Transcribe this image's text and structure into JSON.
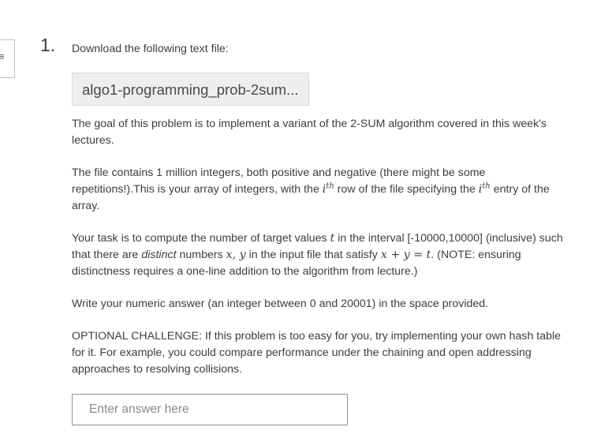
{
  "question": {
    "number": "1.",
    "intro": "Download the following text file:",
    "file_name": "algo1-programming_prob-2sum...",
    "paragraphs": {
      "goal": "The goal of this problem is to implement a variant of the 2-SUM algorithm covered in this week's lectures.",
      "file_desc_part1": "The file contains 1 million integers, both positive and negative (there might be some repetitions!).This is your array of integers, with the",
      "ith_1": "i",
      "th_sup_1": "th",
      "file_desc_part2": "row of the file specifying the",
      "ith_2": "i",
      "th_sup_2": "th",
      "file_desc_part3": "entry of the array.",
      "task_part1": "Your task is to compute the number of target values",
      "t_var": "t",
      "task_part2": "in the interval [-10000,10000] (inclusive) such that there are",
      "distinct_word": "distinct",
      "task_part3": "numbers",
      "xy_vars": "x, y",
      "task_part4": "in the input file that satisfy",
      "equation": "x + y = t",
      "task_part5": ". (NOTE: ensuring distinctness requires a one-line addition to the algorithm from lecture.)",
      "answer_instr": "Write your numeric answer (an integer between 0 and 20001) in the space provided.",
      "optional": "OPTIONAL CHALLENGE: If this problem is too easy for you, try implementing your own hash table for it. For example, you could compare performance under the chaining and open addressing approaches to resolving collisions."
    },
    "answer_placeholder": "Enter answer here",
    "answer_value": ""
  },
  "side_tab": {
    "glyph": "≡"
  }
}
